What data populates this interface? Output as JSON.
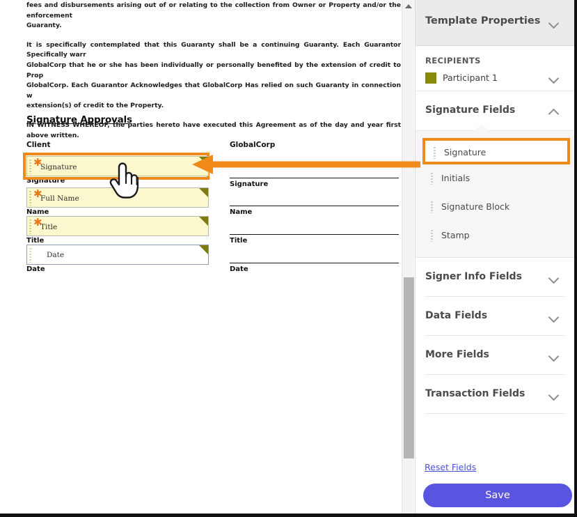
{
  "document": {
    "paragraphs": [
      "fees and disbursements arising out of or relating to the collection from Owner or Property and/or the enforcement\nGuaranty.",
      "It is specifically contemplated that this Guaranty shall be a continuing Guaranty. Each Guarantor Specifically warr\nGlobalCorp that he or she has been individually or personally benefited by the extension of credit to Prop\nGlobalCorp. Each Guarantor Acknowledges that GlobalCorp Has relied on such Guaranty in connection w\nextension(s) of credit to the Property.",
      "IN WITNESS WHEREOF, the parties hereto have executed this Agreement as of the day and year first above written."
    ],
    "section_title": "Signature Approvals",
    "client_column": {
      "heading": "Client",
      "fields": [
        {
          "placeholder": "Signature",
          "caption": "Signature",
          "required": true,
          "selected": true
        },
        {
          "placeholder": "Full Name",
          "caption": "Name",
          "required": true,
          "selected": false
        },
        {
          "placeholder": "Title",
          "caption": "Title",
          "required": true,
          "selected": false
        },
        {
          "placeholder": "Date",
          "caption": "Date",
          "required": false,
          "selected": false
        }
      ]
    },
    "globalcorp_column": {
      "heading": "GlobalCorp",
      "captions": [
        "Signature",
        "Name",
        "Title",
        "Date"
      ]
    }
  },
  "panel": {
    "header": {
      "title": "Template Properties",
      "chevron": "chevron-down-icon"
    },
    "recipients": {
      "label": "RECIPIENTS",
      "participant": "Participant 1",
      "swatch_color": "#8a8a0a",
      "chevron": "chevron-down-icon"
    },
    "signature_fields": {
      "label": "Signature Fields",
      "chevron": "chevron-up-icon",
      "items": [
        {
          "label": "Signature",
          "selected": true
        },
        {
          "label": "Initials",
          "selected": false
        },
        {
          "label": "Signature Block",
          "selected": false
        },
        {
          "label": "Stamp",
          "selected": false
        }
      ]
    },
    "sections": [
      {
        "label": "Signer Info Fields",
        "chevron": "chevron-down-icon"
      },
      {
        "label": "Data Fields",
        "chevron": "chevron-down-icon"
      },
      {
        "label": "More Fields",
        "chevron": "chevron-down-icon"
      },
      {
        "label": "Transaction Fields",
        "chevron": "chevron-down-icon"
      }
    ],
    "reset_link": "Reset Fields",
    "save_label": "Save"
  },
  "colors": {
    "annotation_orange": "#ef8a1b",
    "field_fill": "#fcf8cd",
    "field_corner": "#7d7a10",
    "required_star": "#e8791a",
    "save_purple": "#5a55e0",
    "link_purple": "#4a53d6"
  }
}
